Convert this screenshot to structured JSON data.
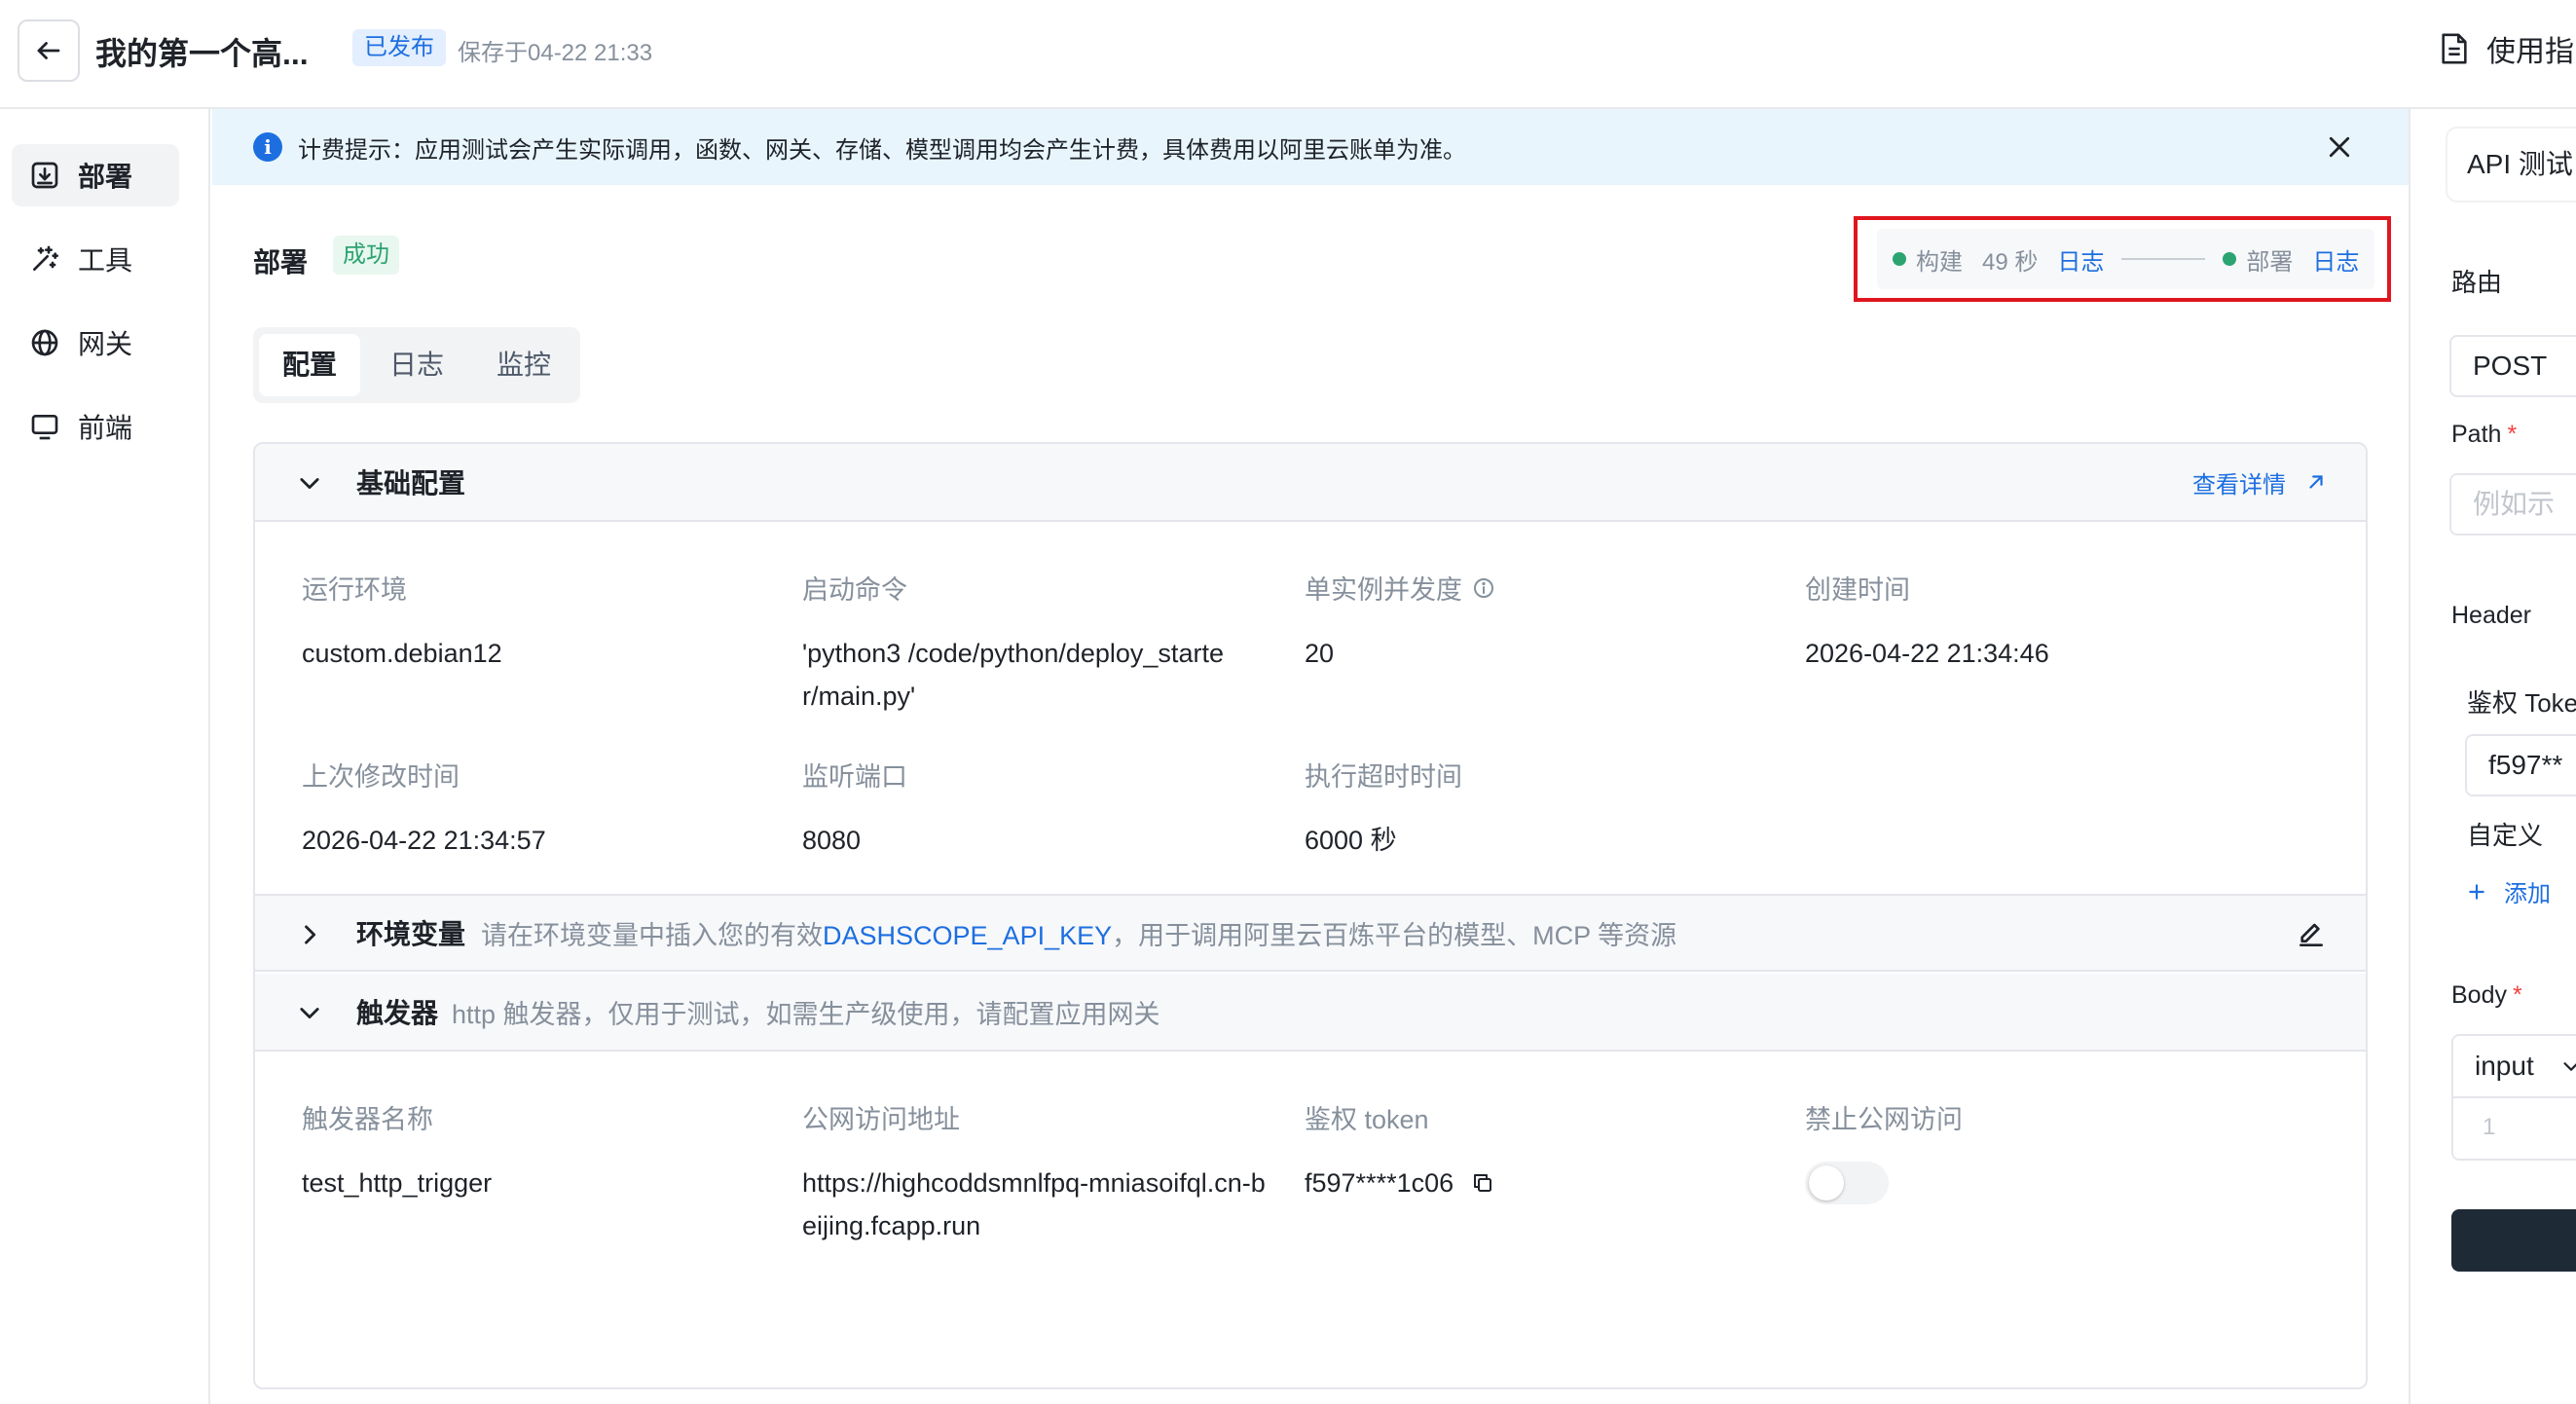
{
  "header": {
    "title": "我的第一个高...",
    "status": "已发布",
    "saved_at": "保存于04-22 21:33",
    "guide_label": "使用指"
  },
  "sidebar": {
    "items": [
      {
        "label": "部署",
        "icon": "deploy-icon"
      },
      {
        "label": "工具",
        "icon": "tools-icon"
      },
      {
        "label": "网关",
        "icon": "globe-icon"
      },
      {
        "label": "前端",
        "icon": "monitor-icon"
      }
    ]
  },
  "banner": {
    "text": "计费提示：应用测试会产生实际调用，函数、网关、存储、模型调用均会产生计费，具体费用以阿里云账单为准。"
  },
  "deploy": {
    "title": "部署",
    "status": "成功",
    "pipeline": {
      "build_label": "构建",
      "build_time": "49 秒",
      "build_log": "日志",
      "deploy_label": "部署",
      "deploy_log": "日志"
    }
  },
  "tabs": [
    "配置",
    "日志",
    "监控"
  ],
  "basic": {
    "title": "基础配置",
    "details_link": "查看详情",
    "fields": {
      "runtime": {
        "label": "运行环境",
        "value": "custom.debian12"
      },
      "command": {
        "label": "启动命令",
        "value": "'python3 /code/python/deploy_starter/main.py'"
      },
      "concurrency": {
        "label": "单实例并发度",
        "value": "20"
      },
      "created": {
        "label": "创建时间",
        "value": "2026-04-22 21:34:46"
      },
      "modified": {
        "label": "上次修改时间",
        "value": "2026-04-22 21:34:57"
      },
      "port": {
        "label": "监听端口",
        "value": "8080"
      },
      "timeout": {
        "label": "执行超时时间",
        "value": "6000 秒"
      }
    }
  },
  "env": {
    "title": "环境变量",
    "desc_before": "请在环境变量中插入您的有效",
    "desc_key": "DASHSCOPE_API_KEY",
    "desc_after": "，用于调用阿里云百炼平台的模型、MCP 等资源"
  },
  "trigger": {
    "title": "触发器",
    "desc": "http 触发器，仅用于测试，如需生产级使用，请配置应用网关",
    "fields": {
      "name": {
        "label": "触发器名称",
        "value": "test_http_trigger"
      },
      "url": {
        "label": "公网访问地址",
        "value": "https://highcoddsmnlfpq-mniasoifql.cn-beijing.fcapp.run"
      },
      "token": {
        "label": "鉴权 token",
        "value": "f597****1c06"
      },
      "block_public": {
        "label": "禁止公网访问",
        "enabled": false
      }
    }
  },
  "api_panel": {
    "tab_label": "API 测试",
    "route_label": "路由",
    "method": "POST",
    "path_label": "Path",
    "path_required": "*",
    "path_placeholder": "例如示",
    "header_label": "Header",
    "auth_token_label": "鉴权 Toke",
    "auth_token_value": "f597**",
    "custom_label": "自定义",
    "add_label": "添加",
    "body_label": "Body",
    "body_required": "*",
    "body_type": "input",
    "body_line": "1"
  },
  "colors": {
    "accent": "#1d6fe0",
    "success": "#2ba471",
    "highlight_box": "#e0161e",
    "banner_bg": "#e8f5fd"
  }
}
